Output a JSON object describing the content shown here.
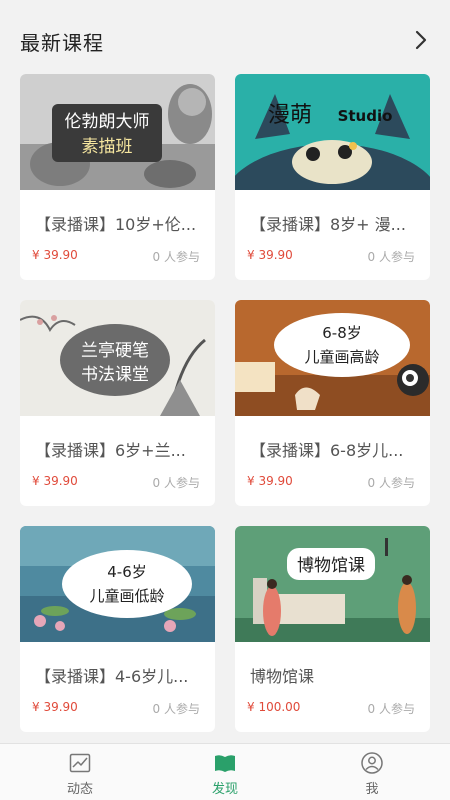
{
  "header": {
    "title": "最新课程",
    "more_icon": "chevron-right-icon"
  },
  "courses": [
    {
      "title": "【录播课】10岁+伦...",
      "price": "¥ 39.90",
      "participants": "0 人参与",
      "thumb_text": [
        "伦勃朗大师",
        "素描班"
      ]
    },
    {
      "title": "【录播课】8岁+ 漫...",
      "price": "¥ 39.90",
      "participants": "0 人参与",
      "thumb_text": [
        "漫萌",
        "Studio"
      ]
    },
    {
      "title": "【录播课】6岁+兰...",
      "price": "¥ 39.90",
      "participants": "0 人参与",
      "thumb_text": [
        "兰亭硬笔",
        "书法课堂"
      ]
    },
    {
      "title": "【录播课】6-8岁儿...",
      "price": "¥ 39.90",
      "participants": "0 人参与",
      "thumb_text": [
        "6-8岁",
        "儿童画高龄"
      ]
    },
    {
      "title": "【录播课】4-6岁儿...",
      "price": "¥ 39.90",
      "participants": "0 人参与",
      "thumb_text": [
        "4-6岁",
        "儿童画低龄"
      ]
    },
    {
      "title": "博物馆课",
      "price": "¥ 100.00",
      "participants": "0 人参与",
      "thumb_text": [
        "博物馆课"
      ]
    }
  ],
  "tabbar": {
    "tabs": [
      {
        "label": "动态",
        "icon": "chart-icon"
      },
      {
        "label": "发现",
        "icon": "book-icon"
      },
      {
        "label": "我",
        "icon": "user-icon"
      }
    ],
    "active": "发现",
    "active_color": "#2aa06a"
  },
  "colors": {
    "price": "#e04a3a",
    "background": "#f2f2f2"
  }
}
